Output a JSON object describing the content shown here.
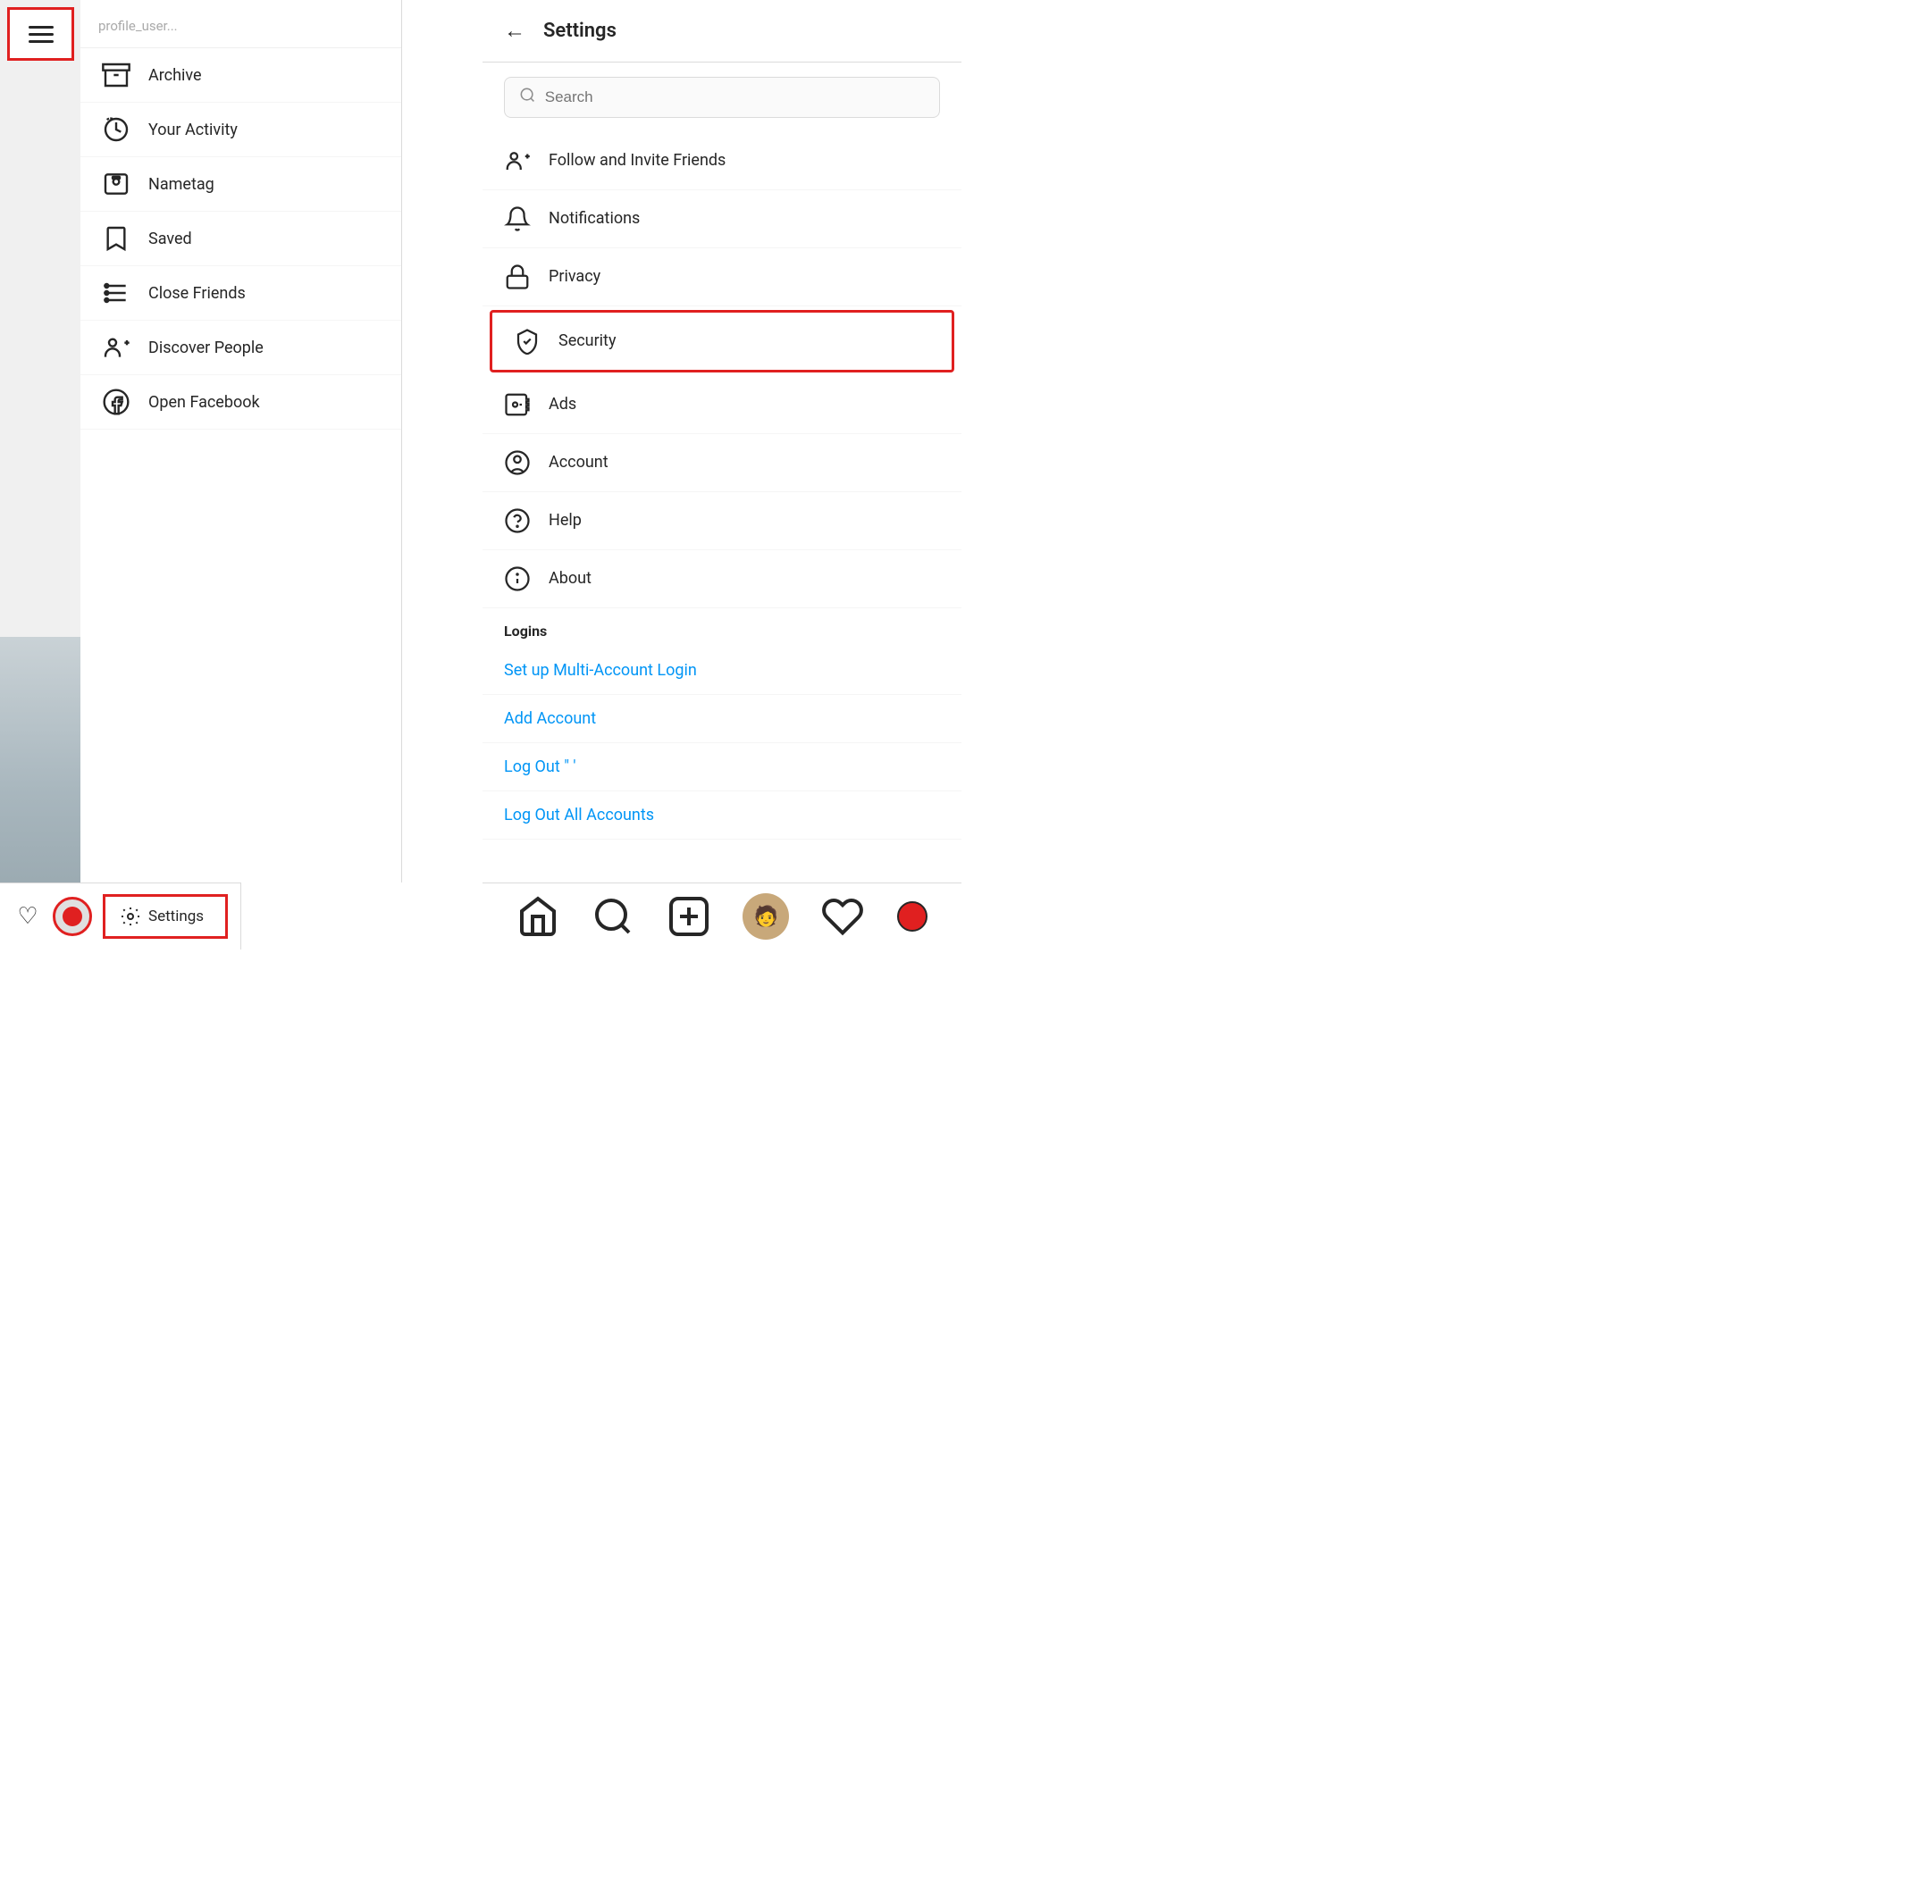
{
  "header": {
    "title": "Settings",
    "back_label": "←"
  },
  "search": {
    "placeholder": "Search",
    "value": ""
  },
  "left_menu": {
    "profile_name": "profile_user...",
    "items": [
      {
        "id": "archive",
        "label": "Archive",
        "icon": "archive-icon"
      },
      {
        "id": "your-activity",
        "label": "Your Activity",
        "icon": "activity-icon"
      },
      {
        "id": "nametag",
        "label": "Nametag",
        "icon": "nametag-icon"
      },
      {
        "id": "saved",
        "label": "Saved",
        "icon": "saved-icon"
      },
      {
        "id": "close-friends",
        "label": "Close Friends",
        "icon": "close-friends-icon"
      },
      {
        "id": "discover-people",
        "label": "Discover People",
        "icon": "discover-icon"
      },
      {
        "id": "open-facebook",
        "label": "Open Facebook",
        "icon": "facebook-icon"
      }
    ]
  },
  "settings_items": [
    {
      "id": "follow-invite",
      "label": "Follow and Invite Friends",
      "icon": "follow-icon"
    },
    {
      "id": "notifications",
      "label": "Notifications",
      "icon": "notifications-icon"
    },
    {
      "id": "privacy",
      "label": "Privacy",
      "icon": "privacy-icon"
    },
    {
      "id": "security",
      "label": "Security",
      "icon": "security-icon",
      "highlighted": true
    },
    {
      "id": "ads",
      "label": "Ads",
      "icon": "ads-icon"
    },
    {
      "id": "account",
      "label": "Account",
      "icon": "account-icon"
    },
    {
      "id": "help",
      "label": "Help",
      "icon": "help-icon"
    },
    {
      "id": "about",
      "label": "About",
      "icon": "about-icon"
    }
  ],
  "logins_section": {
    "heading": "Logins",
    "items": [
      {
        "id": "multi-account",
        "label": "Set up Multi-Account Login"
      },
      {
        "id": "add-account",
        "label": "Add Account"
      },
      {
        "id": "log-out",
        "label": "Log Out \"   '"
      },
      {
        "id": "log-out-all",
        "label": "Log Out All Accounts"
      }
    ]
  },
  "bottom_nav": {
    "home": "⌂",
    "search": "⌕",
    "add": "+",
    "activity": "♡",
    "profile": "●"
  },
  "nav_settings": {
    "label": "Settings"
  }
}
